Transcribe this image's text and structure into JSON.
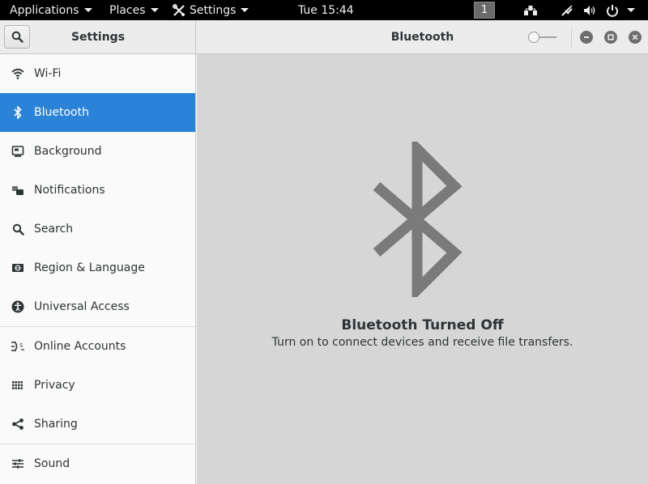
{
  "topbar": {
    "applications": "Applications",
    "places": "Places",
    "settings": "Settings",
    "clock": "Tue 15:44",
    "workspace": "1"
  },
  "window": {
    "sidebar_title": "Settings",
    "main_title": "Bluetooth",
    "bluetooth_toggle_on": false
  },
  "sidebar": {
    "items": [
      {
        "label": "Wi-Fi",
        "icon": "wifi-icon"
      },
      {
        "label": "Bluetooth",
        "icon": "bluetooth-icon",
        "active": true
      },
      {
        "label": "Background",
        "icon": "background-icon"
      },
      {
        "label": "Notifications",
        "icon": "notifications-icon"
      },
      {
        "label": "Search",
        "icon": "search-icon"
      },
      {
        "label": "Region & Language",
        "icon": "region-icon"
      },
      {
        "label": "Universal Access",
        "icon": "universal-access-icon"
      },
      {
        "label": "Online Accounts",
        "icon": "online-accounts-icon"
      },
      {
        "label": "Privacy",
        "icon": "privacy-icon"
      },
      {
        "label": "Sharing",
        "icon": "sharing-icon"
      },
      {
        "label": "Sound",
        "icon": "sound-icon"
      }
    ]
  },
  "main": {
    "status_title": "Bluetooth Turned Off",
    "status_subtitle": "Turn on to connect devices and receive file transfers."
  },
  "colors": {
    "accent": "#2a83d6",
    "topbar": "#000000",
    "main_bg": "#d6d6d6",
    "icon_grey": "#777777"
  }
}
